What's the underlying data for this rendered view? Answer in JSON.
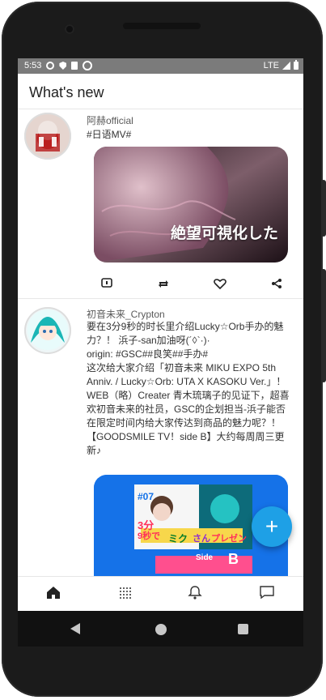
{
  "status_bar": {
    "time": "5:53",
    "network": "LTE",
    "icons": [
      "gear-icon",
      "shield-icon",
      "sim-card-icon",
      "circle-icon",
      "signal-icon",
      "battery-icon"
    ]
  },
  "appbar": {
    "title": "What's new"
  },
  "posts": [
    {
      "name": "阿赫official",
      "text": "#日语MV#",
      "media_text": "絶望可視化した",
      "actions": [
        "comment-icon",
        "repost-icon",
        "like-icon",
        "share-icon"
      ]
    },
    {
      "name": "初音未来_Crypton",
      "text": "要在3分9秒的时长里介绍Lucky☆Orb手办的魅力？！ 浜子-san加油呀(´◊`·)·\norigin: #GSC##良笑##手办#\n这次给大家介绍「初音未来 MIKU EXPO 5th Anniv. / Lucky☆Orb: UTA X KASOKU Ver.」！ WEB（略）Creater 青木琉璃子的见证下，超喜欢初音未来的社员，GSC的企划担当-浜子能否在限定时间内给大家传达到商品的魅力呢？！ 【GOODSMILE TV！side B】大约每周周三更新♪",
      "media_labels": [
        "#07",
        "3分",
        "9秒で",
        "ミク",
        "さん",
        "プレゼン",
        "Side",
        "B"
      ]
    }
  ],
  "fab": {
    "label": "+"
  },
  "bottom_nav": [
    "home-icon",
    "grid-icon",
    "bell-icon",
    "chat-icon"
  ],
  "colors": {
    "accent": "#1ea0e6",
    "status_bar": "#7b7b7b",
    "media_blue": "#1572e8"
  }
}
